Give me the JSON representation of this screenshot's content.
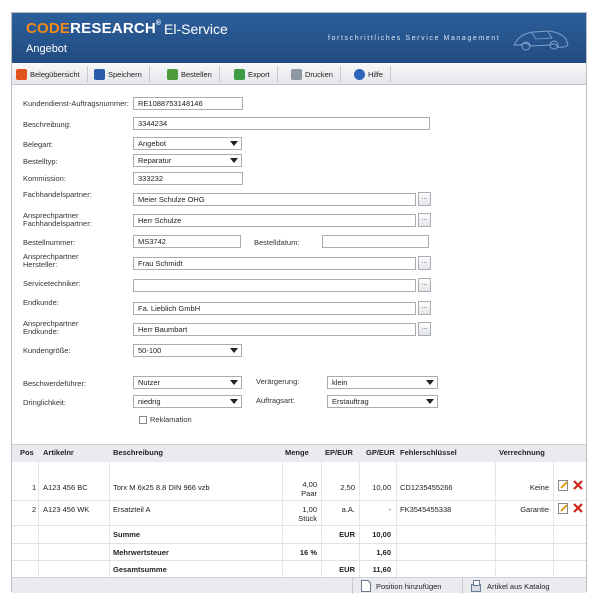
{
  "header": {
    "logo_code": "CODE",
    "logo_research": "RESEARCH",
    "logo_tm": "®",
    "service": "El-Service",
    "tagline": "fortschrittliches Service Management",
    "subtitle": "Angebot"
  },
  "toolbar": {
    "beleg": "Belegübersicht",
    "save": "Speichern",
    "order": "Bestellen",
    "export": "Export",
    "print": "Drucken",
    "help": "Hilfe"
  },
  "form": {
    "auftrag_label": "Kundendienst-Auftragsnummer:",
    "auftrag_value": "RE1088753148146",
    "beschreibung_label": "Beschreibung:",
    "beschreibung_value": "3344234",
    "belegart_label": "Belegart:",
    "belegart_value": "Angebot",
    "bestelltyp_label": "Bestelltyp:",
    "bestelltyp_value": "Reparatur",
    "kommission_label": "Kommission:",
    "kommission_value": "333232",
    "fachhandel_label": "Fachhandelspartner:",
    "fachhandel_value": "Meier Schulze OHG",
    "ansprech_fach_label1": "Ansprechpartner",
    "ansprech_fach_label2": "Fachhandelspartner:",
    "ansprech_fach_value": "Herr Schulze",
    "bestellnummer_label": "Bestellnummer:",
    "bestellnummer_value": "MS3742",
    "bestelldatum_label": "Bestelldatum:",
    "bestelldatum_value": "",
    "ansprech_hersteller_label1": "Ansprechpartner",
    "ansprech_hersteller_label2": "Hersteller:",
    "ansprech_hersteller_value": "Frau Schmidt",
    "servicetechniker_label": "Servicetechniker:",
    "servicetechniker_value": "",
    "endkunde_label": "Endkunde:",
    "endkunde_value": "Fa. Lieblich GmbH",
    "ansprech_end_label1": "Ansprechpartner",
    "ansprech_end_label2": "Endkunde:",
    "ansprech_end_value": "Herr Baumbart",
    "kundengroesse_label": "Kundengröße:",
    "kundengroesse_value": "50-100",
    "beschwerde_label": "Beschwerdeführer:",
    "beschwerde_value": "Nutzer",
    "veraergerung_label": "Verärgerung:",
    "veraergerung_value": "klein",
    "dringlichkeit_label": "Dringlichkeit:",
    "dringlichkeit_value": "niedrig",
    "auftragsart_label": "Auftragsart:",
    "auftragsart_value": "Erstauftrag",
    "reklamation_label": "Reklamation",
    "dots": "..."
  },
  "table": {
    "headers": [
      "Pos",
      "Artikelnr",
      "Beschreibung",
      "Menge",
      "EP/EUR",
      "GP/EUR",
      "Fehlerschlüssel",
      "Verrechnung"
    ],
    "rows": [
      {
        "pos": "1",
        "artikelnr": "A123 456 BC",
        "beschreibung": "Torx M 6x25 8.8 DIN 966 vzb",
        "menge": "4,00",
        "einheit": "Paar",
        "ep": "2,50",
        "gp": "10,00",
        "fehler": "CD1235455266",
        "verrechnung": "Keine"
      },
      {
        "pos": "2",
        "artikelnr": "A123 456 WK",
        "beschreibung": "Ersatzteil A",
        "menge": "1,00",
        "einheit": "Stück",
        "ep": "a.A.",
        "gp": "-",
        "fehler": "FK3545455338",
        "verrechnung": "Garantie"
      }
    ],
    "summe_label": "Summe",
    "summe_currency": "EUR",
    "summe_value": "10,00",
    "mwst_label": "Mehrwertsteuer",
    "mwst_rate": "16 %",
    "mwst_value": "1,60",
    "gesamt_label": "Gesamtsumme",
    "gesamt_currency": "EUR",
    "gesamt_value": "11,60"
  },
  "footer": {
    "add_position": "Position hinzufügen",
    "add_catalog": "Artikel aus Katalog"
  },
  "colors": {
    "brand": "#2c5f9b",
    "accent": "#f28a1c",
    "delete": "#d0281b"
  }
}
